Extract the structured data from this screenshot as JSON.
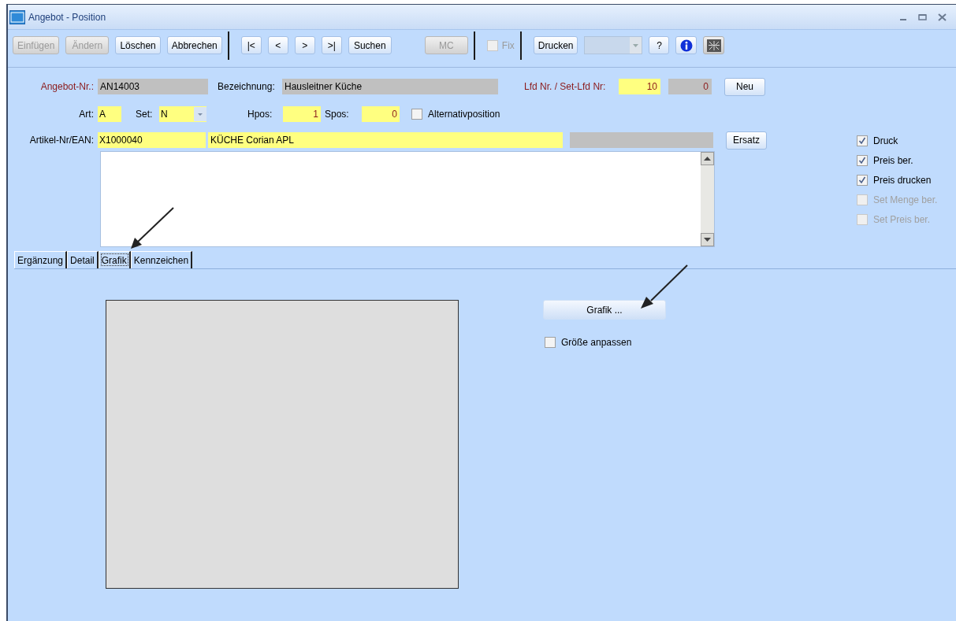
{
  "window": {
    "title": "Angebot - Position"
  },
  "toolbar": [
    {
      "divider_before": false,
      "items": [
        {
          "kind": "button",
          "label": "Einfügen",
          "disabled": true
        },
        {
          "kind": "button",
          "label": "Ändern",
          "disabled": true
        },
        {
          "kind": "button",
          "label": "Löschen",
          "disabled": false
        },
        {
          "kind": "button",
          "label": "Abbrechen",
          "disabled": false
        }
      ]
    },
    {
      "divider_before": true,
      "items": [
        {
          "kind": "nav",
          "label": "|<",
          "disabled": false
        },
        {
          "kind": "nav",
          "label": "<",
          "disabled": false
        },
        {
          "kind": "nav",
          "label": ">",
          "disabled": false
        },
        {
          "kind": "nav",
          "label": ">|",
          "disabled": false
        },
        {
          "kind": "button",
          "label": "Suchen",
          "disabled": false
        }
      ]
    },
    {
      "divider_before": false,
      "items": [
        {
          "kind": "button",
          "label": "MC",
          "disabled": true
        }
      ]
    },
    {
      "divider_before": true,
      "items": [
        {
          "kind": "checkbox",
          "label": "Fix",
          "checked": false,
          "disabled": true
        }
      ]
    },
    {
      "divider_before": true,
      "items": [
        {
          "kind": "button",
          "label": "Drucken",
          "disabled": false
        },
        {
          "kind": "dropdown",
          "disabled": true
        },
        {
          "kind": "nav",
          "label": "?",
          "disabled": false
        },
        {
          "kind": "info",
          "disabled": false
        },
        {
          "kind": "layout",
          "disabled": false
        }
      ]
    }
  ],
  "offer": {
    "label": "Angebot-Nr.:",
    "value": "AN14003"
  },
  "designation": {
    "label": "Bezeichnung:",
    "value": "Hausleitner Küche"
  },
  "sequence": {
    "label": "Lfd Nr. / Set-Lfd Nr:",
    "value": "10",
    "set_value": "0"
  },
  "new_button": "Neu",
  "art": {
    "label": "Art:",
    "value": "A"
  },
  "set": {
    "label": "Set:",
    "value": "N"
  },
  "hpos": {
    "label": "Hpos:",
    "value": "1"
  },
  "spos": {
    "label": "Spos:",
    "value": "0"
  },
  "alternative": {
    "label": "Alternativposition",
    "checked": false
  },
  "article": {
    "label": "Artikel-Nr/EAN:",
    "number": "X1000040",
    "description": "KÜCHE Corian APL"
  },
  "replace_button": "Ersatz",
  "options": [
    {
      "label": "Druck",
      "checked": true,
      "disabled": false
    },
    {
      "label": "Preis ber.",
      "checked": true,
      "disabled": false
    },
    {
      "label": "Preis drucken",
      "checked": true,
      "disabled": false
    },
    {
      "label": "Set Menge ber.",
      "checked": false,
      "disabled": true
    },
    {
      "label": "Set Preis ber.",
      "checked": false,
      "disabled": true
    }
  ],
  "tabs": [
    {
      "label": "Ergänzung",
      "selected": false
    },
    {
      "label": "Detail",
      "selected": false
    },
    {
      "label": "Grafik",
      "selected": true
    },
    {
      "label": "Kennzeichen",
      "selected": false
    }
  ],
  "graphic": {
    "button": "Grafik ...",
    "fit": {
      "label": "Größe anpassen",
      "checked": false
    }
  }
}
